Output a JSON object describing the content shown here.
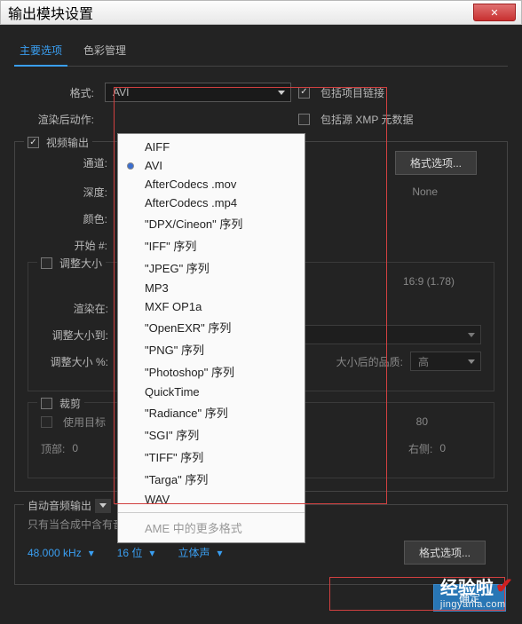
{
  "window": {
    "title": "输出模块设置",
    "close": "✕"
  },
  "tabs": {
    "main": "主要选项",
    "color": "色彩管理"
  },
  "format": {
    "label": "格式:",
    "value": "AVI",
    "include_link_label": "包括项目链接",
    "post_render_label": "渲染后动作:",
    "include_xmp_label": "包括源 XMP 元数据"
  },
  "dropdown": {
    "items": [
      "AIFF",
      "AVI",
      "AfterCodecs .mov",
      "AfterCodecs .mp4",
      "\"DPX/Cineon\" 序列",
      "\"IFF\" 序列",
      "\"JPEG\" 序列",
      "MP3",
      "MXF OP1a",
      "\"OpenEXR\" 序列",
      "\"PNG\" 序列",
      "\"Photoshop\" 序列",
      "QuickTime",
      "\"Radiance\" 序列",
      "\"SGI\" 序列",
      "\"TIFF\" 序列",
      "\"Targa\" 序列",
      "WAV"
    ],
    "selected": "AVI",
    "more": "AME 中的更多格式"
  },
  "video": {
    "output_label": "视频输出",
    "channel_label": "通道:",
    "depth_label": "深度:",
    "color_label": "颜色:",
    "start_label": "开始 #:",
    "format_options_btn": "格式选项...",
    "none_value": "None"
  },
  "resize": {
    "label": "调整大小",
    "aspect_info": "16:9 (1.78)",
    "render_at_label": "渲染在:",
    "resize_to_label": "调整大小到:",
    "resize_pct_label": "调整大小 %:",
    "quality_label": "大小后的品质:",
    "quality_value": "高"
  },
  "crop": {
    "label": "裁剪",
    "use_target_label": "使用目标",
    "top_label": "顶部:",
    "top_value": "0",
    "right_label": "右侧:",
    "right_value": "0",
    "eighty": "80"
  },
  "audio": {
    "auto_label": "自动音频输出",
    "hint": "只有当合成中含有音频时，才会输出音频。",
    "khz": "48.000 kHz",
    "bit": "16 位",
    "stereo": "立体声",
    "format_options_btn": "格式选项..."
  },
  "footer": {
    "ok": "确定"
  },
  "watermark": {
    "cn": "经验啦",
    "en": "jingyanla.com"
  }
}
